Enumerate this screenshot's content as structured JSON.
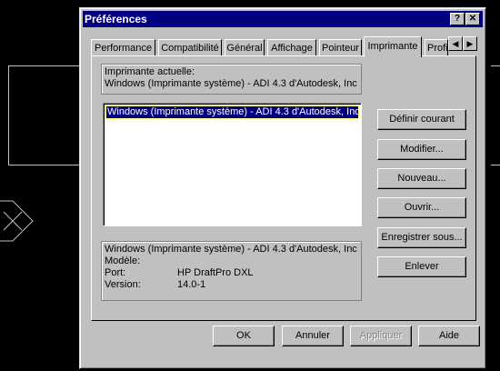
{
  "dialog": {
    "title": "Préférences",
    "help_glyph": "?",
    "close_glyph": "✕"
  },
  "tabs": [
    {
      "label": "Performance"
    },
    {
      "label": "Compatibilité"
    },
    {
      "label": "Général"
    },
    {
      "label": "Affichage"
    },
    {
      "label": "Pointeur"
    },
    {
      "label": "Imprimante",
      "active": true
    },
    {
      "label": "Profil"
    }
  ],
  "tab_scroll": {
    "left": "◀",
    "right": "▶"
  },
  "current_printer": {
    "label": "Imprimante actuelle:",
    "value": "Windows (Imprimante système) - ADI 4.3 d'Autodesk, Inc"
  },
  "printer_list": {
    "items": [
      "Windows (Imprimante système) - ADI 4.3 d'Autodesk, Inc"
    ]
  },
  "details": {
    "line1": "Windows (Imprimante système) - ADI 4.3 d'Autodesk, Inc",
    "model_label": "Modèle:",
    "model_value": "",
    "port_label": "Port:",
    "port_value": "HP DraftPro DXL",
    "version_label": "Version:",
    "version_value": "14.0-1"
  },
  "side_buttons": {
    "set_current": "Définir courant",
    "modify": "Modifier...",
    "new": "Nouveau...",
    "open": "Ouvrir...",
    "save_as": "Enregistrer sous...",
    "remove": "Enlever"
  },
  "bottom_buttons": {
    "ok": "OK",
    "cancel": "Annuler",
    "apply": "Appliquer",
    "help": "Aide"
  },
  "colors": {
    "titlebar": "#000080",
    "face": "#c0c0c0",
    "desktop": "#000000"
  }
}
